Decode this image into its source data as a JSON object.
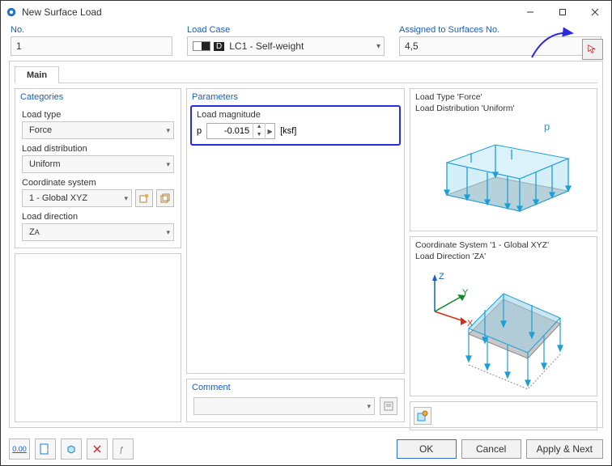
{
  "window": {
    "title": "New Surface Load"
  },
  "header": {
    "no_label": "No.",
    "no_value": "1",
    "loadcase_label": "Load Case",
    "loadcase_value": "LC1 - Self-weight",
    "loadcase_badge": "D",
    "assigned_label": "Assigned to Surfaces No.",
    "assigned_value": "4,5"
  },
  "tabs": {
    "main": "Main"
  },
  "categories": {
    "title": "Categories",
    "load_type_label": "Load type",
    "load_type_value": "Force",
    "load_distribution_label": "Load distribution",
    "load_distribution_value": "Uniform",
    "coord_label": "Coordinate system",
    "coord_value": "1 - Global XYZ",
    "load_direction_label": "Load direction",
    "load_direction_value": "Z",
    "load_direction_sub": "A"
  },
  "parameters": {
    "title": "Parameters",
    "subtitle": "Load magnitude",
    "symbol": "p",
    "value": "-0.015",
    "unit": "[ksf]"
  },
  "preview": {
    "line1a": "Load Type ",
    "line1b": "'Force'",
    "line2a": "Load Distribution ",
    "line2b": "'Uniform'",
    "p_label": "p",
    "line3a": "Coordinate System ",
    "line3b": "'1 - Global XYZ'",
    "line4a": "Load Direction ",
    "line4b": "'Z",
    "line4c": "A",
    "line4d": "'",
    "axis_z": "Z",
    "axis_y": "Y",
    "axis_x": "X"
  },
  "comment": {
    "title": "Comment",
    "value": ""
  },
  "buttons": {
    "ok": "OK",
    "cancel": "Cancel",
    "apply_next": "Apply & Next"
  }
}
